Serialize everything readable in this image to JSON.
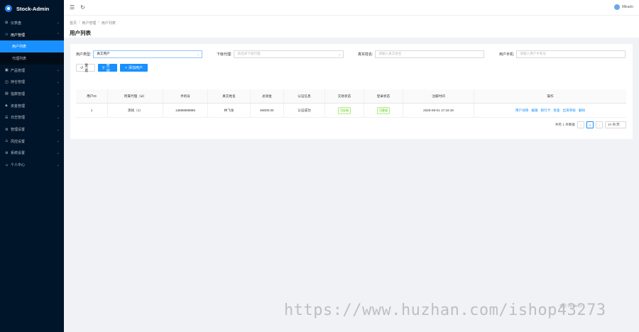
{
  "app": {
    "title": "Stock-Admin"
  },
  "sidebar": {
    "items": [
      {
        "label": "仪表盘",
        "icon": "dashboard-icon",
        "arrow": "⌄"
      },
      {
        "label": "用户管理",
        "icon": "user-group-icon",
        "arrow": "⌃",
        "open": true,
        "children": [
          {
            "label": "用户列表",
            "active": true
          },
          {
            "label": "代理列表"
          }
        ]
      },
      {
        "label": "产品管理",
        "icon": "product-icon",
        "arrow": "⌄"
      },
      {
        "label": "持仓管理",
        "icon": "position-icon",
        "arrow": "⌄"
      },
      {
        "label": "指数管理",
        "icon": "index-icon",
        "arrow": "⌄"
      },
      {
        "label": "资金管理",
        "icon": "funds-icon",
        "arrow": "⌄"
      },
      {
        "label": "日志管理",
        "icon": "log-icon",
        "arrow": "⌄"
      },
      {
        "label": "管理设置",
        "icon": "admin-settings-icon",
        "arrow": "⌄"
      },
      {
        "label": "风控设置",
        "icon": "risk-icon",
        "arrow": "⌄"
      },
      {
        "label": "系统设置",
        "icon": "system-settings-icon",
        "arrow": "⌄"
      },
      {
        "label": "个人中心",
        "icon": "person-icon",
        "arrow": "⌄"
      }
    ]
  },
  "header": {
    "username": "Mikado"
  },
  "breadcrumb": [
    "首页",
    "用户管理",
    "用户列表"
  ],
  "page_title": "用户列表",
  "filters": {
    "user_type": {
      "label": "用户类型:",
      "value": "真实用户"
    },
    "agent": {
      "label": "下级代理:",
      "placeholder": "请选择下级代理"
    },
    "real_name": {
      "label": "真实姓名:",
      "placeholder": "请输入真实姓名"
    },
    "phone": {
      "label": "用户手机:",
      "placeholder": "请输入用户手机号"
    }
  },
  "buttons": {
    "reset": "重置",
    "search": "查询",
    "add_user": "添加用户"
  },
  "table": {
    "columns": [
      "用户ID",
      "所属代理（id）",
      "手机号",
      "真实姓名",
      "总资金",
      "认证信息",
      "交易状态",
      "登录状态",
      "注册时间",
      "操作"
    ],
    "rows": [
      {
        "id": "1",
        "agent": "测试（1）",
        "phone": "13888888886",
        "real_name": "林飞龙",
        "total_funds": "59000.00",
        "auth": "认证成功",
        "trade_status": "可交易",
        "login_status": "可登录",
        "reg_time": "2025-08-01 17:16:19",
        "ops": [
          "用户详情",
          "编辑",
          "银行卡",
          "资金",
          "出资审核",
          "删除"
        ]
      }
    ]
  },
  "pagination": {
    "total_text": "共有 1 条数据",
    "current": "1",
    "page_size": "10 条/页"
  },
  "watermark": {
    "text": "https://www.huzhan.com/ishop43273",
    "small": "激活 Windows"
  },
  "colors": {
    "primary": "#1890ff",
    "sidebar_bg": "#001529",
    "success": "#52c41a"
  }
}
